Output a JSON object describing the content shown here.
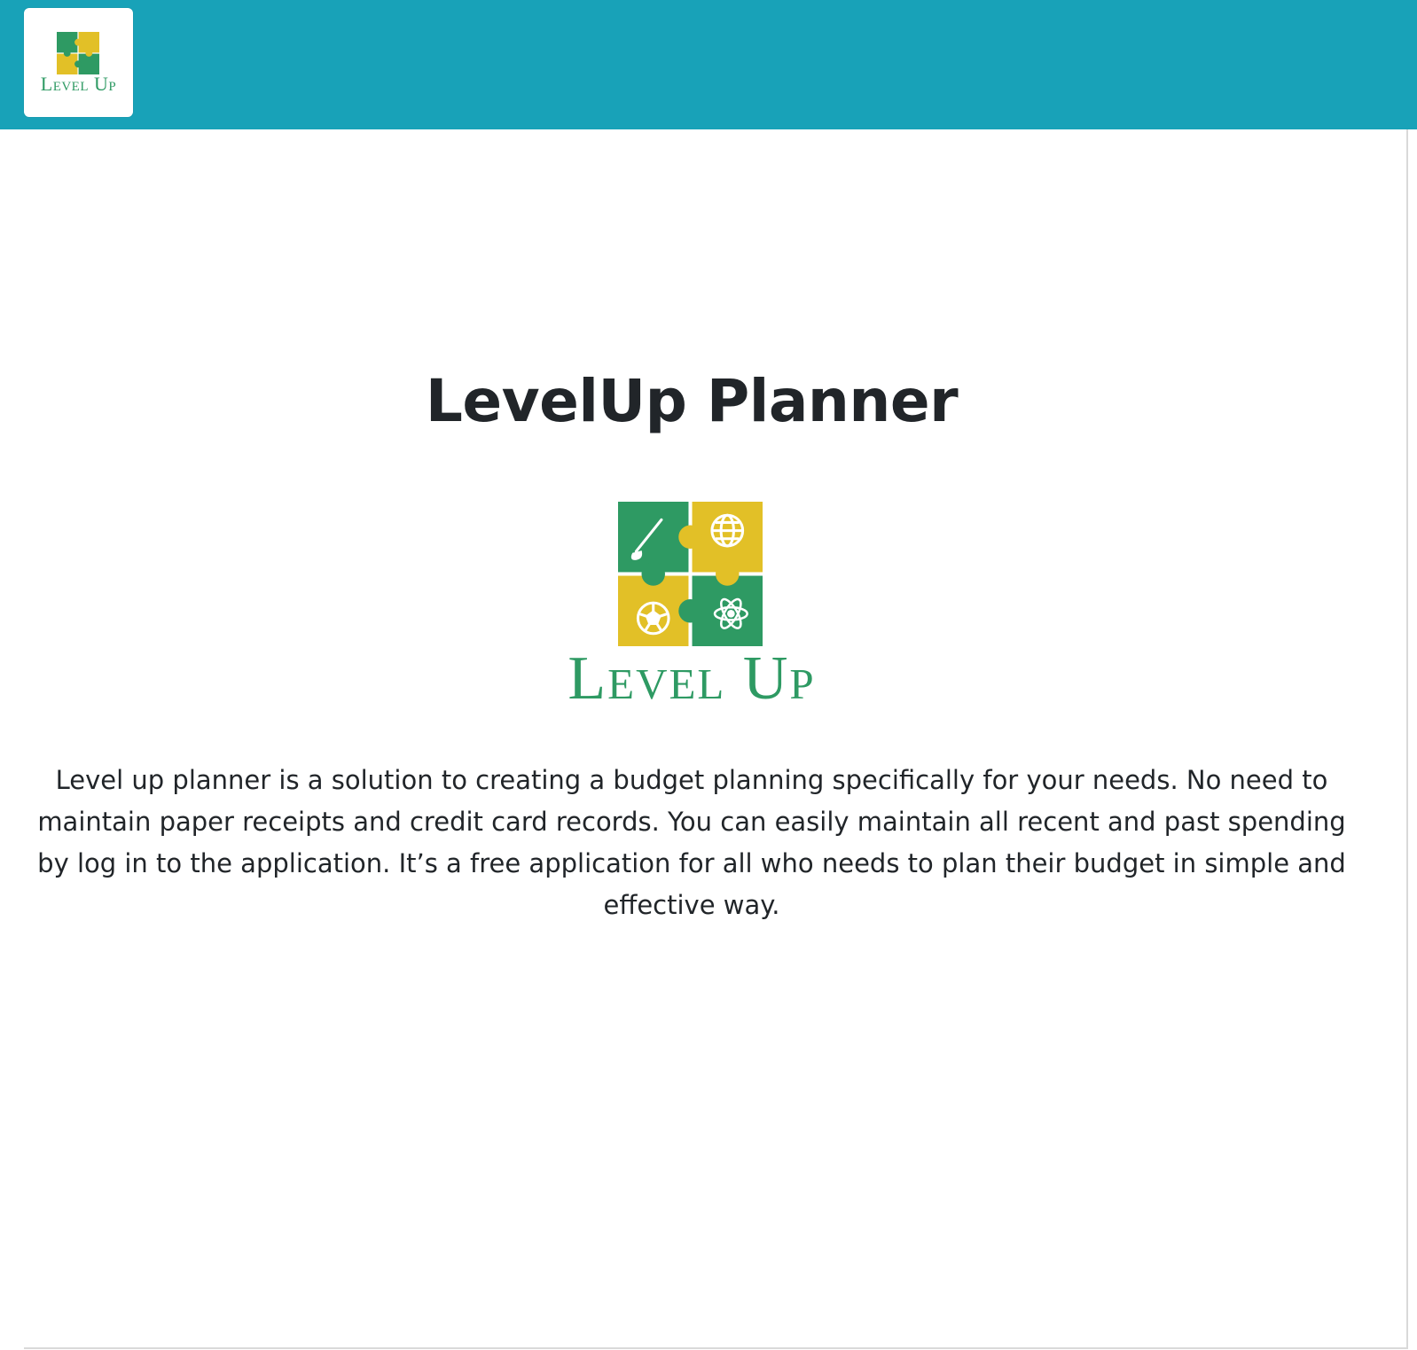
{
  "header": {
    "logo": {
      "wordmark": "Level Up",
      "colors": {
        "green": "#2e9a63",
        "yellow": "#e2c027"
      }
    },
    "bar_color": "#18a2b8"
  },
  "main": {
    "title": "LevelUp Planner",
    "hero_logo": {
      "wordmark": "Level Up",
      "icons": [
        "paintbrush-icon",
        "globe-icon",
        "soccer-ball-icon",
        "atom-icon"
      ]
    },
    "description": "Level up planner is a solution to creating a budget planning specifically for your needs. No need to maintain paper receipts and credit card records. You can easily maintain all recent and past spending by log in to the application. It’s a free application for all who needs to plan their budget in simple and effective way."
  }
}
